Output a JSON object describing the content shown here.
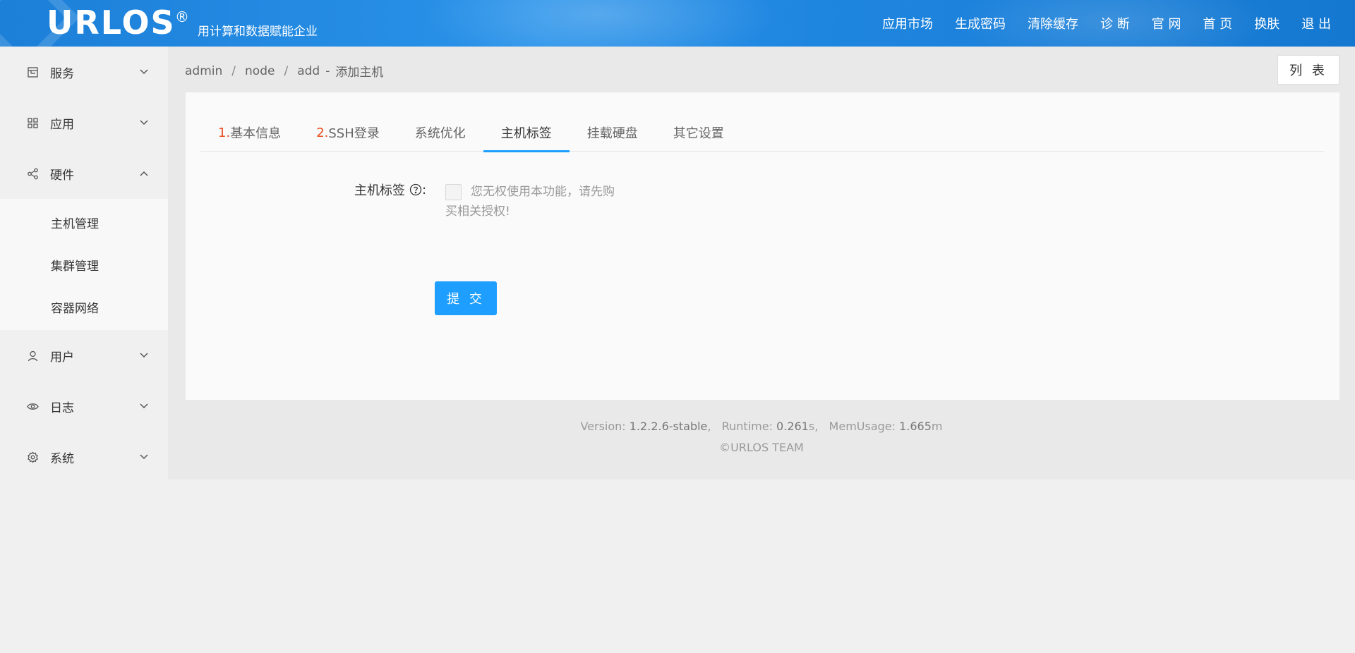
{
  "header": {
    "logo": "URLOS",
    "logo_reg": "®",
    "slogan": "用计算和数据赋能企业",
    "nav": [
      "应用市场",
      "生成密码",
      "清除缓存",
      "诊 断",
      "官 网",
      "首 页",
      "换肤",
      "退 出"
    ]
  },
  "sidebar": {
    "items": [
      {
        "label": "服务",
        "icon": "shop-icon"
      },
      {
        "label": "应用",
        "icon": "grid-icon"
      },
      {
        "label": "硬件",
        "icon": "share-icon"
      },
      {
        "label": "用户",
        "icon": "user-icon"
      },
      {
        "label": "日志",
        "icon": "eye-icon"
      },
      {
        "label": "系统",
        "icon": "gear-icon"
      }
    ],
    "hardware_sub": [
      "主机管理",
      "集群管理",
      "容器网络"
    ]
  },
  "breadcrumb": {
    "parts": [
      "admin",
      "node",
      "add"
    ],
    "sep": "/",
    "dash": "-",
    "title": "添加主机"
  },
  "list_button": "列 表",
  "tabs": [
    {
      "num": "1.",
      "label": "基本信息"
    },
    {
      "num": "2.",
      "label": "SSH登录"
    },
    {
      "num": "",
      "label": "系统优化"
    },
    {
      "num": "",
      "label": "主机标签"
    },
    {
      "num": "",
      "label": "挂载硬盘"
    },
    {
      "num": "",
      "label": "其它设置"
    }
  ],
  "form": {
    "label": "主机标签",
    "colon": ":",
    "no_permission": "您无权使用本功能，请先购买相关授权!",
    "submit": "提 交"
  },
  "footer": {
    "version_label": "Version: ",
    "version": "1.2.2.6-stable",
    "runtime_label": ",   Runtime: ",
    "runtime": "0.261",
    "runtime_unit": "s,",
    "mem_label": "   MemUsage: ",
    "mem": "1.665",
    "mem_unit": "m",
    "copyright": "©URLOS TEAM"
  },
  "colors": {
    "primary": "#1e9fff",
    "header": "#2a93ea",
    "tab_number": "#e84d1c"
  }
}
